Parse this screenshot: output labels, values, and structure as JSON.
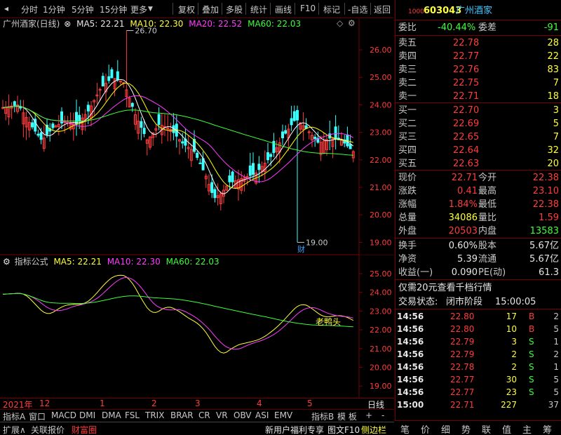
{
  "toolbar": {
    "periods": [
      "分时",
      "1分钟",
      "5分钟",
      "15分钟",
      "更多"
    ],
    "actions": [
      "复权",
      "叠加",
      "多股",
      "统计",
      "画线",
      "F10",
      "标记",
      "-自选",
      "返回"
    ]
  },
  "main_chart": {
    "title": "广州酒家(日线)",
    "ma5": "MA5: 22.21",
    "ma10": "MA10: 22.30",
    "ma20": "MA20: 22.52",
    "ma60": "MA60: 22.03",
    "high_label": "26.70",
    "low_label": "19.00",
    "cai_label": "财",
    "yticks": [
      "26.00",
      "25.00",
      "24.00",
      "23.00",
      "22.00",
      "21.00",
      "20.00",
      "19.00"
    ]
  },
  "indicator": {
    "title": "指标公式",
    "ma5": "MA5: 22.21",
    "ma10": "MA10: 22.30",
    "ma60": "MA60: 22.03",
    "annotation": "老鸭头",
    "yticks": [
      "25.00",
      "24.00",
      "23.00",
      "22.00",
      "21.00",
      "20.00",
      "19.00"
    ]
  },
  "time_axis": {
    "labels": [
      "2021年",
      "12",
      "1",
      "2",
      "3",
      "4",
      "5"
    ],
    "period": "日线"
  },
  "bottom_tabs": [
    "指标A",
    "窗口",
    "MACD",
    "DMI",
    "DMA",
    "FSL",
    "TRIX",
    "BRAR",
    "CR",
    "VR",
    "OBV",
    "ASI",
    "EMV",
    "指标B",
    "模 板",
    "+",
    "-"
  ],
  "bottom_bar": {
    "expand": "扩展∧",
    "related": "关联报价",
    "fortune": "财富圈",
    "promo": "新用户福利专享",
    "f10": "图文F10",
    "sidebar": "侧边栏"
  },
  "quote": {
    "code_prefix": "1000",
    "code": "603043",
    "name": "广州酒家",
    "weibi_label": "委比",
    "weibi": "-40.44%",
    "weicha_label": "委差",
    "weicha": "-91",
    "asks": [
      {
        "label": "卖五",
        "price": "22.78",
        "vol": "28"
      },
      {
        "label": "卖四",
        "price": "22.77",
        "vol": "22"
      },
      {
        "label": "卖三",
        "price": "22.76",
        "vol": "83"
      },
      {
        "label": "卖二",
        "price": "22.75",
        "vol": "7"
      },
      {
        "label": "卖一",
        "price": "22.71",
        "vol": "18"
      }
    ],
    "bids": [
      {
        "label": "买一",
        "price": "22.70",
        "vol": "3"
      },
      {
        "label": "买二",
        "price": "22.69",
        "vol": "5"
      },
      {
        "label": "买三",
        "price": "22.65",
        "vol": "7"
      },
      {
        "label": "买四",
        "price": "22.64",
        "vol": "32"
      },
      {
        "label": "买五",
        "price": "22.63",
        "vol": "20"
      }
    ],
    "stats": [
      {
        "l1": "现价",
        "v1": "22.71",
        "l2": "今开",
        "v2": "22.38"
      },
      {
        "l1": "涨跌",
        "v1": "0.41",
        "l2": "最高",
        "v2": "23.10"
      },
      {
        "l1": "涨幅",
        "v1": "1.84%",
        "l2": "最低",
        "v2": "22.38"
      },
      {
        "l1": "总量",
        "v1": "34086",
        "l2": "量比",
        "v2": "1.59"
      },
      {
        "l1": "外盘",
        "v1": "20503",
        "l2": "内盘",
        "v2": "13583"
      }
    ],
    "stats2": [
      {
        "l1": "换手",
        "v1": "0.60%",
        "l2": "股本",
        "v2": "5.67亿"
      },
      {
        "l1": "净资",
        "v1": "5.39",
        "l2": "流通",
        "v2": "5.67亿"
      },
      {
        "l1": "收益(一)",
        "v1": "0.090",
        "l2": "PE(动)",
        "v2": "61.3"
      }
    ],
    "promo": "仅需20元查看千档行情",
    "status_label": "交易状态:",
    "status": "闭市阶段",
    "status_time": "15:00:05",
    "ticks": [
      {
        "t": "14:56",
        "p": "22.80",
        "v": "17",
        "bs": "B",
        "n": "2"
      },
      {
        "t": "14:56",
        "p": "22.80",
        "v": "10",
        "bs": "B",
        "n": "5"
      },
      {
        "t": "14:56",
        "p": "22.79",
        "v": "3",
        "bs": "S",
        "n": "1"
      },
      {
        "t": "14:56",
        "p": "22.79",
        "v": "2",
        "bs": "S",
        "n": "2"
      },
      {
        "t": "14:56",
        "p": "22.78",
        "v": "2",
        "bs": "S",
        "n": "1"
      },
      {
        "t": "14:56",
        "p": "22.77",
        "v": "30",
        "bs": "S",
        "n": "5"
      },
      {
        "t": "14:56",
        "p": "22.77",
        "v": "23",
        "bs": "S",
        "n": "5"
      },
      {
        "t": "15:00",
        "p": "22.71",
        "v": "227",
        "bs": "",
        "n": "37"
      }
    ],
    "nav": [
      "笔",
      "价",
      "细",
      "势",
      "联",
      "值",
      "主",
      "筹"
    ]
  },
  "colors": {
    "up": "#ff3c3c",
    "down": "#3cffff",
    "ma5": "#ffffff",
    "ma10": "#ffff00",
    "ma20": "#ff3cff",
    "ma60": "#3cff3c",
    "grid": "#7a0000"
  }
}
